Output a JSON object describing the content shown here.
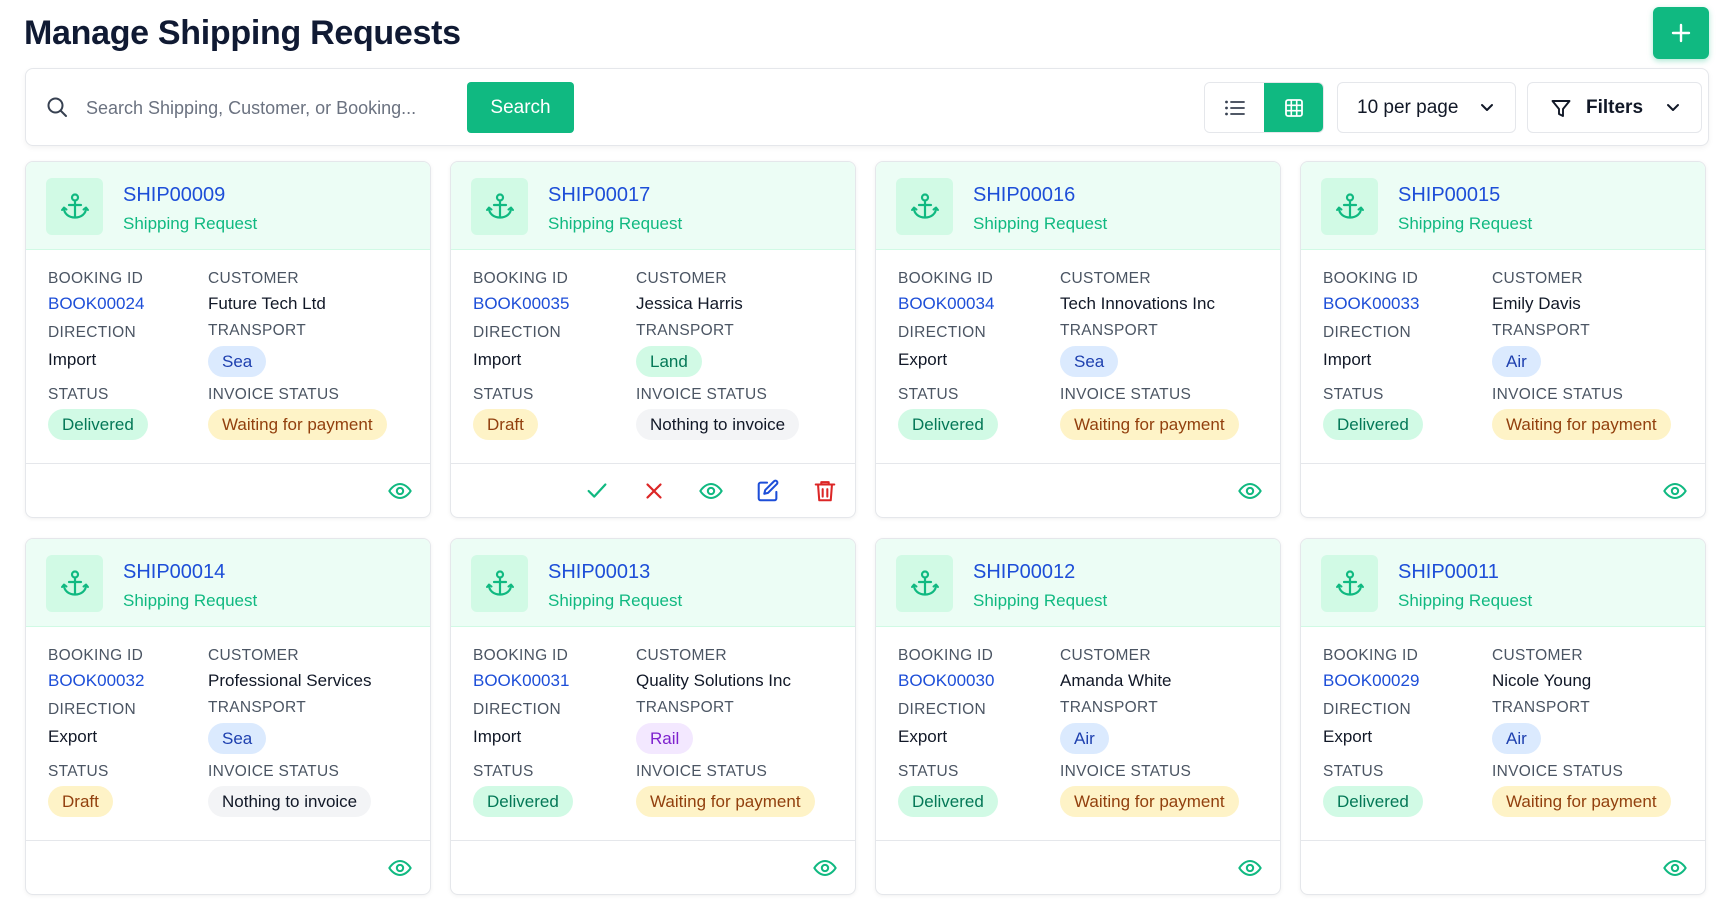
{
  "page": {
    "title": "Manage Shipping Requests",
    "add_button_icon": "plus-icon"
  },
  "toolbar": {
    "search_placeholder": "Search Shipping, Customer, or Booking...",
    "search_value": "",
    "search_button": "Search",
    "view_modes": [
      "list",
      "grid"
    ],
    "active_view": "grid",
    "per_page": "10 per page",
    "filters": "Filters"
  },
  "labels": {
    "booking_id": "BOOKING ID",
    "customer": "CUSTOMER",
    "direction": "DIRECTION",
    "transport": "TRANSPORT",
    "status": "STATUS",
    "invoice_status": "INVOICE STATUS"
  },
  "colors": {
    "primary": "#10b981",
    "link": "#1d4ed8",
    "danger": "#dc2626",
    "title": "#101a33"
  },
  "cards": [
    {
      "id": "SHIP00009",
      "type": "Shipping Request",
      "booking": "BOOK00024",
      "customer": "Future Tech Ltd",
      "direction": "Import",
      "transport": "Sea",
      "status": "Delivered",
      "invoice": "Waiting for payment",
      "actions": [
        "view"
      ]
    },
    {
      "id": "SHIP00017",
      "type": "Shipping Request",
      "booking": "BOOK00035",
      "customer": "Jessica Harris",
      "direction": "Import",
      "transport": "Land",
      "status": "Draft",
      "invoice": "Nothing to invoice",
      "actions": [
        "approve",
        "reject",
        "view",
        "edit",
        "delete"
      ]
    },
    {
      "id": "SHIP00016",
      "type": "Shipping Request",
      "booking": "BOOK00034",
      "customer": "Tech Innovations Inc",
      "direction": "Export",
      "transport": "Sea",
      "status": "Delivered",
      "invoice": "Waiting for payment",
      "actions": [
        "view"
      ]
    },
    {
      "id": "SHIP00015",
      "type": "Shipping Request",
      "booking": "BOOK00033",
      "customer": "Emily Davis",
      "direction": "Import",
      "transport": "Air",
      "status": "Delivered",
      "invoice": "Waiting for payment",
      "actions": [
        "view"
      ]
    },
    {
      "id": "SHIP00014",
      "type": "Shipping Request",
      "booking": "BOOK00032",
      "customer": "Professional Services",
      "direction": "Export",
      "transport": "Sea",
      "status": "Draft",
      "invoice": "Nothing to invoice",
      "actions": [
        "view"
      ]
    },
    {
      "id": "SHIP00013",
      "type": "Shipping Request",
      "booking": "BOOK00031",
      "customer": "Quality Solutions Inc",
      "direction": "Import",
      "transport": "Rail",
      "status": "Delivered",
      "invoice": "Waiting for payment",
      "actions": [
        "view"
      ]
    },
    {
      "id": "SHIP00012",
      "type": "Shipping Request",
      "booking": "BOOK00030",
      "customer": "Amanda White",
      "direction": "Export",
      "transport": "Air",
      "status": "Delivered",
      "invoice": "Waiting for payment",
      "actions": [
        "view"
      ]
    },
    {
      "id": "SHIP00011",
      "type": "Shipping Request",
      "booking": "BOOK00029",
      "customer": "Nicole Young",
      "direction": "Export",
      "transport": "Air",
      "status": "Delivered",
      "invoice": "Waiting for payment",
      "actions": [
        "view"
      ]
    }
  ]
}
